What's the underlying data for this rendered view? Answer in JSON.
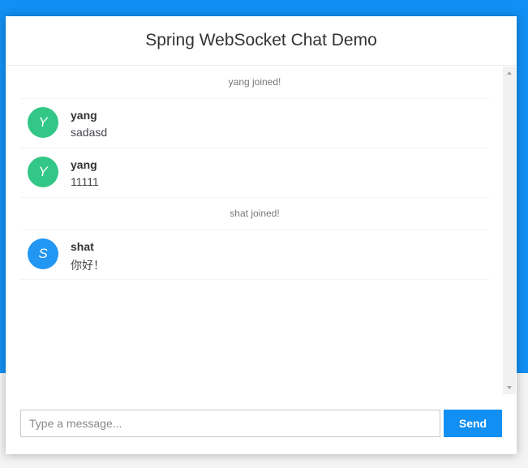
{
  "header": {
    "title": "Spring WebSocket Chat Demo"
  },
  "messages": [
    {
      "type": "event",
      "text": "yang joined!"
    },
    {
      "type": "chat",
      "sender": "yang",
      "avatar_letter": "Y",
      "avatar_color": "#32c787",
      "text": "sadasd"
    },
    {
      "type": "chat",
      "sender": "yang",
      "avatar_letter": "Y",
      "avatar_color": "#32c787",
      "text": "11111"
    },
    {
      "type": "event",
      "text": "shat joined!"
    },
    {
      "type": "chat",
      "sender": "shat",
      "avatar_letter": "S",
      "avatar_color": "#2196f3",
      "text": "你好！"
    }
  ],
  "input": {
    "placeholder": "Type a message...",
    "value": ""
  },
  "send_button": {
    "label": "Send"
  },
  "colors": {
    "accent": "#128ff2",
    "background": "#f4f4f4"
  }
}
